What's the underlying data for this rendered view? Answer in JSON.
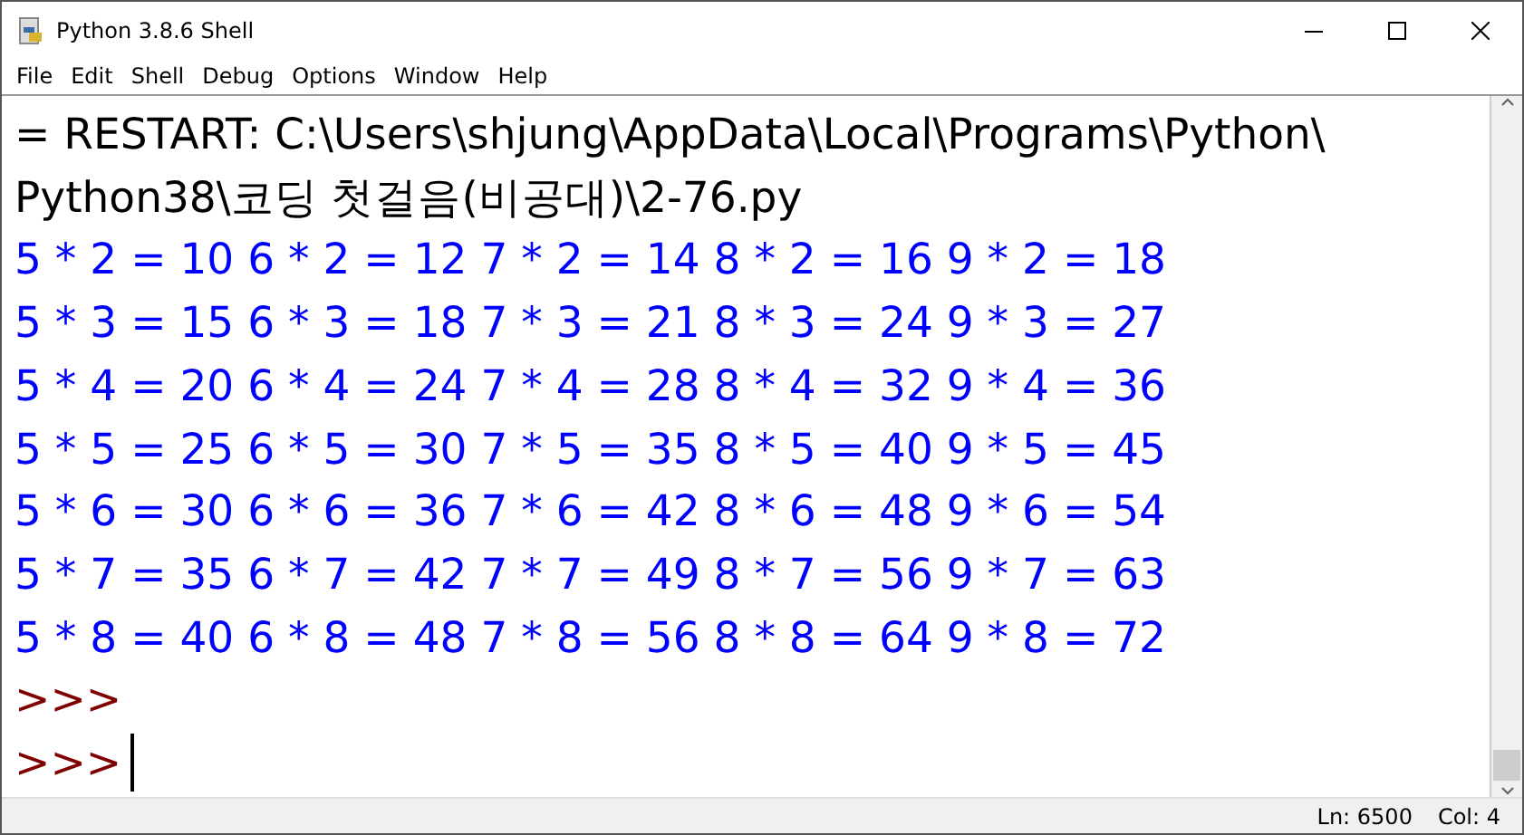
{
  "window": {
    "title": "Python 3.8.6 Shell"
  },
  "menu": [
    "File",
    "Edit",
    "Shell",
    "Debug",
    "Options",
    "Window",
    "Help"
  ],
  "shell": {
    "lines": [
      {
        "kind": "restart",
        "text": "= RESTART: C:\\Users\\shjung\\AppData\\Local\\Programs\\Python\\"
      },
      {
        "kind": "restart",
        "text": "Python38\\코딩 첫걸음(비공대)\\2-76.py"
      },
      {
        "kind": "output",
        "text": "5 * 2 = 10 6 * 2 = 12 7 * 2 = 14 8 * 2 = 16 9 * 2 = 18"
      },
      {
        "kind": "output",
        "text": "5 * 3 = 15 6 * 3 = 18 7 * 3 = 21 8 * 3 = 24 9 * 3 = 27"
      },
      {
        "kind": "output",
        "text": "5 * 4 = 20 6 * 4 = 24 7 * 4 = 28 8 * 4 = 32 9 * 4 = 36"
      },
      {
        "kind": "output",
        "text": "5 * 5 = 25 6 * 5 = 30 7 * 5 = 35 8 * 5 = 40 9 * 5 = 45"
      },
      {
        "kind": "output",
        "text": "5 * 6 = 30 6 * 6 = 36 7 * 6 = 42 8 * 6 = 48 9 * 6 = 54"
      },
      {
        "kind": "output",
        "text": "5 * 7 = 35 6 * 7 = 42 7 * 7 = 49 8 * 7 = 56 9 * 7 = 63"
      },
      {
        "kind": "output",
        "text": "5 * 8 = 40 6 * 8 = 48 7 * 8 = 56 8 * 8 = 64 9 * 8 = 72"
      },
      {
        "kind": "prompt",
        "text": ">>>"
      },
      {
        "kind": "prompt",
        "text": ">>>",
        "cursor": true
      }
    ]
  },
  "status_bar": {
    "line": "Ln: 6500",
    "col": "Col: 4"
  }
}
